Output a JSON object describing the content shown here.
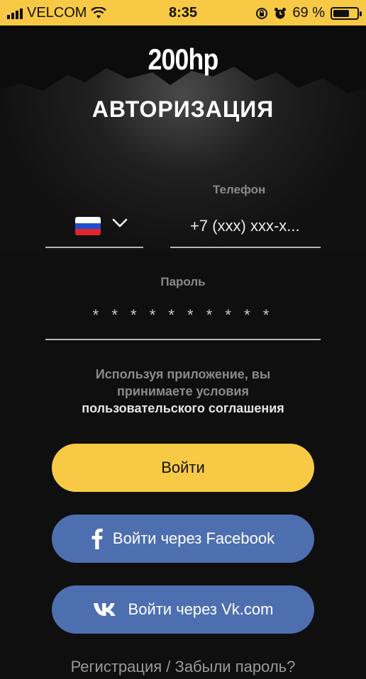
{
  "status_bar": {
    "carrier": "VELCOM",
    "time": "8:35",
    "battery_percent": "69 %",
    "battery_level": 0.69
  },
  "logo": "200hp",
  "page_title": "АВТОРИЗАЦИЯ",
  "phone": {
    "label": "Телефон",
    "value": "+7  (xxx) xxx-x...",
    "country_flag": "ru-flag"
  },
  "password": {
    "label": "Пароль",
    "value": "* * * * * * * * * *"
  },
  "terms": {
    "line1": "Используя приложение, вы",
    "line2": "принимаете условия",
    "link": "пользовательского соглашения"
  },
  "buttons": {
    "login": "Войти",
    "facebook": "Войти через Facebook",
    "vk": "Войти через Vk.com"
  },
  "bottom_links": "Регистрация / Забыли пароль?",
  "colors": {
    "accent": "#f7c945",
    "social": "#4d6fb0",
    "background": "#0f0f0f"
  }
}
